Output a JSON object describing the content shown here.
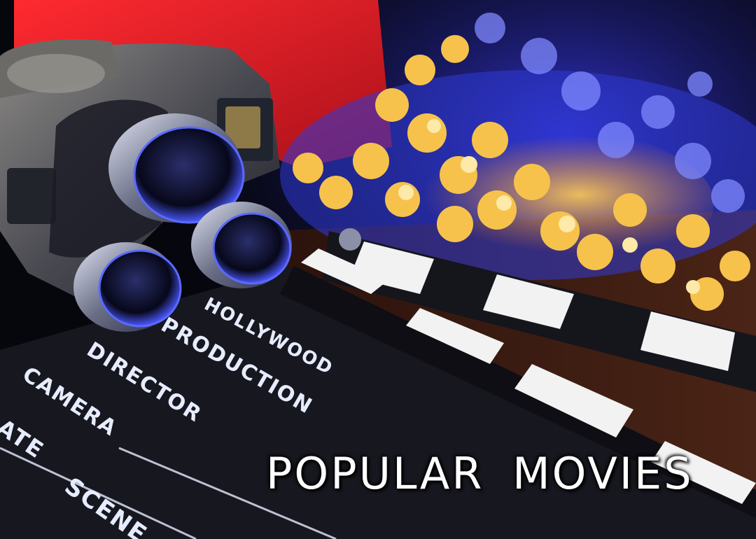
{
  "headline": "POPULAR  MOVIES",
  "clapperboard_labels": {
    "hollywood": "HOLLYWOOD",
    "production": "PRODUCTION",
    "director": "DIRECTOR",
    "camera": "CAMERA",
    "date": "DATE",
    "scene": "SCENE"
  },
  "colors": {
    "popcorn_box_red": "#e8202a",
    "popcorn_gold": "#f5b23a",
    "blue_light": "#3a4cff",
    "clapper_black": "#15151c",
    "clapper_white": "#f2f2f2"
  }
}
